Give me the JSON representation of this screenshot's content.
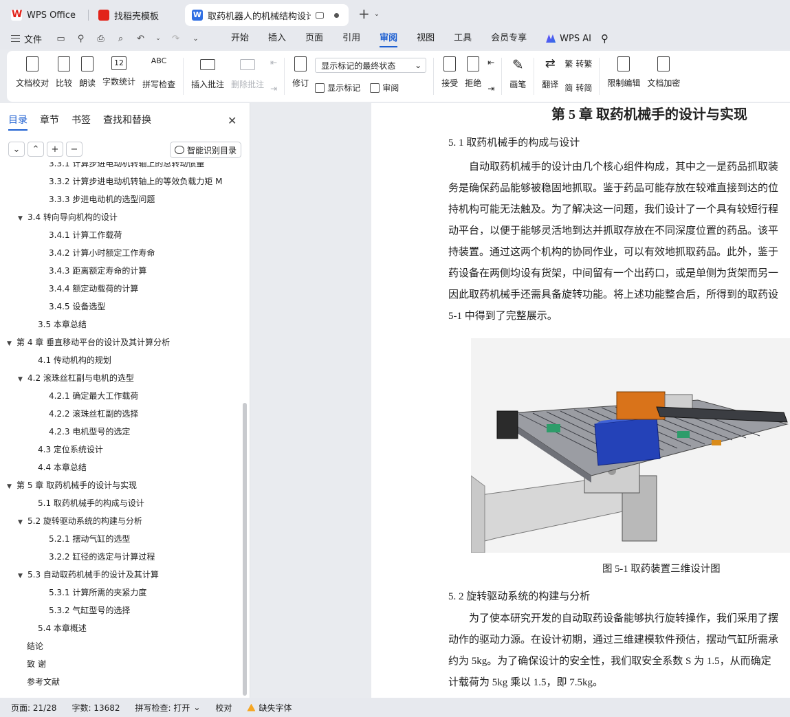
{
  "tabs": [
    {
      "label": "WPS Office"
    },
    {
      "label": "找稻壳模板"
    },
    {
      "label": "取药机器人的机械结构设计 说",
      "badge": "W"
    }
  ],
  "menubar": {
    "file": "文件",
    "items": [
      "开始",
      "插入",
      "页面",
      "引用",
      "审阅",
      "视图",
      "工具",
      "会员专享"
    ],
    "active": "审阅",
    "wps_ai": "WPS AI"
  },
  "ribbon": {
    "doc_check": "文档校对",
    "compare": "比较",
    "read_aloud": "朗读",
    "word_count": "字数统计",
    "word_count_glyph": "12",
    "spell_check": "拼写检查",
    "spell_glyph": "ABC",
    "insert_comment": "插入批注",
    "delete_comment": "删除批注",
    "track_changes": "修订",
    "markup_state": "显示标记的最终状态",
    "show_markup": "显示标记",
    "review": "审阅",
    "accept": "接受",
    "reject": "拒绝",
    "pen": "画笔",
    "translate": "翻译",
    "to_traditional": "转繁",
    "to_simplified": "转简",
    "restrict_edit": "限制编辑",
    "doc_encrypt": "文档加密"
  },
  "leftpanel": {
    "tabs": [
      "目录",
      "章节",
      "书签",
      "查找和替换"
    ],
    "active_tab": "目录",
    "smart_toc": "智能识别目录",
    "toc": [
      {
        "text": "3.3.1 计算步进电动机转轴上的总转动惯量",
        "level": 3
      },
      {
        "text": "3.3.2 计算步进电动机转轴上的等效负载力矩 M",
        "level": 3
      },
      {
        "text": "3.3.3 步进电动机的选型问题",
        "level": 3
      },
      {
        "text": "3.4 转向导向机构的设计",
        "level": 2,
        "expanded": true
      },
      {
        "text": "3.4.1 计算工作载荷",
        "level": 3
      },
      {
        "text": "3.4.2 计算小时额定工作寿命",
        "level": 3
      },
      {
        "text": "3.4.3  距离额定寿命的计算",
        "level": 3
      },
      {
        "text": "3.4.4  额定动载荷的计算",
        "level": 3
      },
      {
        "text": "3.4.5  设备选型",
        "level": 3
      },
      {
        "text": "3.5  本章总结",
        "level": 2
      },
      {
        "text": "第 4 章  垂直移动平台的设计及其计算分析",
        "level": 1,
        "expanded": true
      },
      {
        "text": "4.1  传动机构的规划",
        "level": 2
      },
      {
        "text": "4.2  滚珠丝杠副与电机的选型",
        "level": 2,
        "expanded": true
      },
      {
        "text": "4.2.1  确定最大工作载荷",
        "level": 3
      },
      {
        "text": "4.2.2  滚珠丝杠副的选择",
        "level": 3
      },
      {
        "text": "4.2.3  电机型号的选定",
        "level": 3
      },
      {
        "text": "4.3  定位系统设计",
        "level": 2
      },
      {
        "text": "4.4  本章总结",
        "level": 2
      },
      {
        "text": "第 5 章  取药机械手的设计与实现",
        "level": 1,
        "expanded": true
      },
      {
        "text": "5.1  取药机械手的构成与设计",
        "level": 2
      },
      {
        "text": "5.2  旋转驱动系统的构建与分析",
        "level": 2,
        "expanded": true
      },
      {
        "text": "5.2.1  摆动气缸的选型",
        "level": 3
      },
      {
        "text": "3.2.2  缸径的选定与计算过程",
        "level": 3
      },
      {
        "text": "5.3  自动取药机械手的设计及其计算",
        "level": 2,
        "expanded": true
      },
      {
        "text": "5.3.1  计算所需的夹紧力度",
        "level": 3
      },
      {
        "text": "5.3.2  气缸型号的选择",
        "level": 3
      },
      {
        "text": "5.4  本章概述",
        "level": 2
      },
      {
        "text": "结论",
        "level": 1
      },
      {
        "text": "致  谢",
        "level": 1
      },
      {
        "text": "参考文献",
        "level": 1
      }
    ]
  },
  "document": {
    "chapter_title": "第 5 章  取药机械手的设计与实现",
    "section1_heading": "5. 1  取药机械手的构成与设计",
    "section1_lines": [
      "　　自动取药机械手的设计由几个核心组件构成，其中之一是药品抓取装",
      "务是确保药品能够被稳固地抓取。鉴于药品可能存放在较难直接到达的位",
      "持机构可能无法触及。为了解决这一问题，我们设计了一个具有较短行程",
      "动平台，以便于能够灵活地到达并抓取存放在不同深度位置的药品。该平",
      "持装置。通过这两个机构的协同作业，可以有效地抓取药品。此外，鉴于",
      "药设备在两侧均设有货架，中间留有一个出药口，或是单侧为货架而另一",
      "因此取药机械手还需具备旋转功能。将上述功能整合后，所得到的取药设",
      "5-1 中得到了完整展示。"
    ],
    "figure_caption": "图 5-1 取药装置三维设计图",
    "section2_heading": "5. 2  旋转驱动系统的构建与分析",
    "section2_lines": [
      "　　为了使本研究开发的自动取药设备能够执行旋转操作，我们采用了摆",
      "动作的驱动力源。在设计初期，通过三维建模软件预估，摆动气缸所需承",
      "约为 5kg。为了确保设计的安全性，我们取安全系数 S 为 1.5，从而确定",
      "计载荷为 5kg 乘以 1.5，即 7.5kg。"
    ]
  },
  "statusbar": {
    "page": "页面: 21/28",
    "words": "字数: 13682",
    "spell": "拼写检查: 打开",
    "proof": "校对",
    "missing_font": "缺失字体"
  }
}
